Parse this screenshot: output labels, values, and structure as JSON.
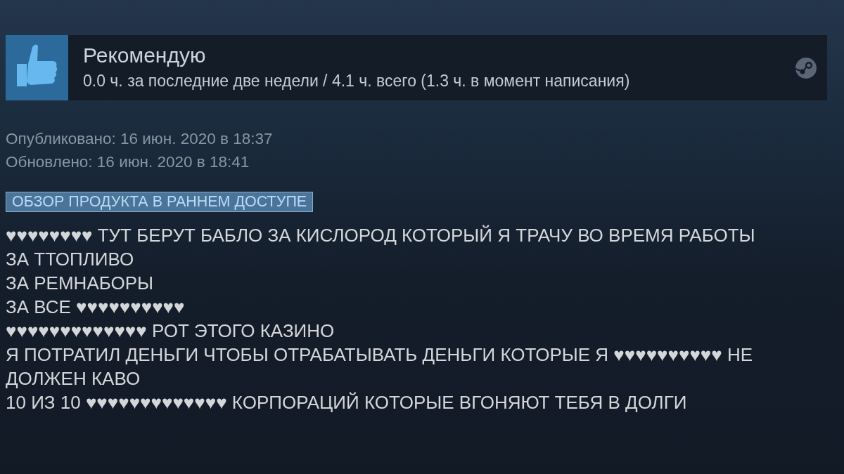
{
  "header": {
    "verdict": "Рекомендую",
    "hours": "0.0 ч. за последние две недели / 4.1 ч. всего (1.3 ч. в момент написания)"
  },
  "dates": [
    "Опубликовано: 16 июн. 2020 в 18:37",
    "Обновлено: 16 июн. 2020 в 18:41"
  ],
  "tag": "ОБЗОР ПРОДУКТА В РАННЕМ ДОСТУПЕ",
  "review_lines": [
    "♥♥♥♥♥♥♥♥ ТУТ БЕРУТ БАБЛО ЗА КИСЛОРОД КОТОРЫЙ Я ТРАЧУ ВО ВРЕМЯ РАБОТЫ",
    "ЗА ТТОПЛИВО",
    "ЗА РЕМНАБОРЫ",
    "ЗА ВСЕ ♥♥♥♥♥♥♥♥♥♥",
    "♥♥♥♥♥♥♥♥♥♥♥♥♥ РОТ ЭТОГО КАЗИНО",
    "Я ПОТРАТИЛ ДЕНЬГИ ЧТОБЫ ОТРАБАТЫВАТЬ ДЕНЬГИ КОТОРЫЕ Я ♥♥♥♥♥♥♥♥♥♥ НЕ ДОЛЖЕН КАВО",
    "10 ИЗ 10 ♥♥♥♥♥♥♥♥♥♥♥♥♥ КОРПОРАЦИЙ КОТОРЫЕ ВГОНЯЮТ ТЕБЯ В ДОЛГИ"
  ]
}
